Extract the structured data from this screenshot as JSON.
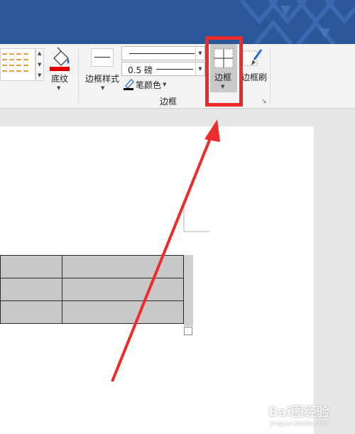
{
  "ribbon": {
    "shading_label": "底纹",
    "border_styles_label": "边框样式",
    "pen_weight_value": "0.5 磅",
    "pen_color_label": "笔颜色",
    "borders_label": "边框",
    "border_painter_label": "边框刷",
    "group_label": "边框"
  },
  "watermark": {
    "text": "Bai图经验",
    "sub": "jingyan.baidu.com"
  },
  "colors": {
    "title_bar": "#2b579a",
    "highlight": "#ee2b2b",
    "shading_bar": "#e00000",
    "table_cell": "#c8c8c8"
  }
}
